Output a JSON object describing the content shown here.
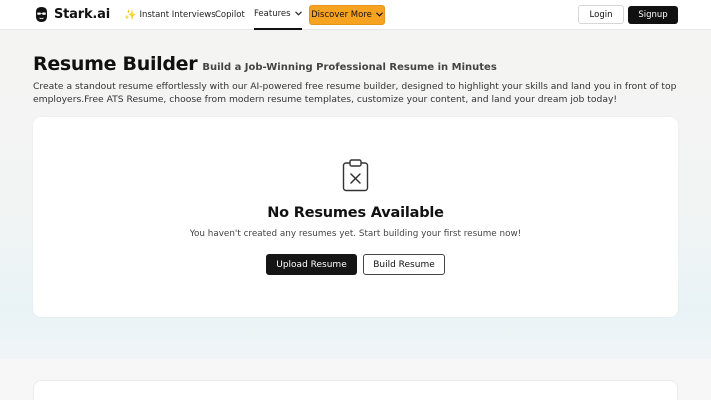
{
  "nav": {
    "brand": "Stark.ai",
    "links": {
      "interviews": "Instant Interviews",
      "copilot": "Copilot",
      "features": "Features"
    },
    "discover": "Discover More",
    "login": "Login",
    "signup": "Signup",
    "chevron": "❯",
    "spark": "✨"
  },
  "header": {
    "title": "Resume Builder",
    "subtitle": "Build a Job-Winning Professional Resume in Minutes",
    "description": "Create a standout resume effortlessly with our AI-powered free resume builder, designed to highlight your skills and land you in front of top employers.Free ATS Resume, choose from modern resume templates, customize your content, and land your dream job today!"
  },
  "empty_state": {
    "icon": "clipboard-x-icon",
    "title": "No Resumes Available",
    "message": "You haven't created any resumes yet. Start building your first resume now!",
    "upload_label": "Upload Resume",
    "build_label": "Build Resume"
  },
  "colors": {
    "accent": "#f6a321",
    "dark": "#111111"
  }
}
